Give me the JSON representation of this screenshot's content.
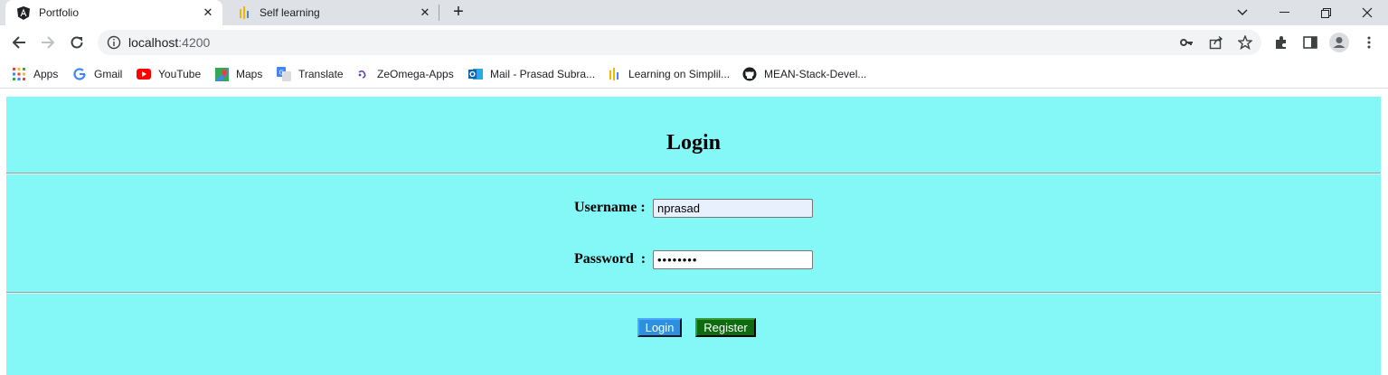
{
  "browser": {
    "tabs": [
      {
        "title": "Portfolio",
        "active": true,
        "icon": "angular-icon"
      },
      {
        "title": "Self learning",
        "active": false,
        "icon": "simplilearn-icon"
      }
    ],
    "url": {
      "host": "localhost",
      "port": ":4200"
    },
    "bookmarks": [
      {
        "label": "Apps",
        "icon": "apps-grid-icon"
      },
      {
        "label": "Gmail",
        "icon": "google-icon"
      },
      {
        "label": "YouTube",
        "icon": "youtube-icon"
      },
      {
        "label": "Maps",
        "icon": "maps-icon"
      },
      {
        "label": "Translate",
        "icon": "translate-icon"
      },
      {
        "label": "ZeOmega-Apps",
        "icon": "zeomega-icon"
      },
      {
        "label": "Mail - Prasad Subra...",
        "icon": "outlook-icon"
      },
      {
        "label": "Learning on Simplil...",
        "icon": "simplilearn-icon"
      },
      {
        "label": "MEAN-Stack-Devel...",
        "icon": "github-icon"
      }
    ]
  },
  "page": {
    "background": "#84f7f7",
    "heading": "Login",
    "username": {
      "label": "Username :",
      "value": "nprasad"
    },
    "password": {
      "label": "Password  :",
      "masked_value": "••••••••"
    },
    "buttons": {
      "login": "Login",
      "register": "Register"
    },
    "colors": {
      "login_button": "#2d8fe0",
      "register_button": "#0f6b0f"
    }
  }
}
